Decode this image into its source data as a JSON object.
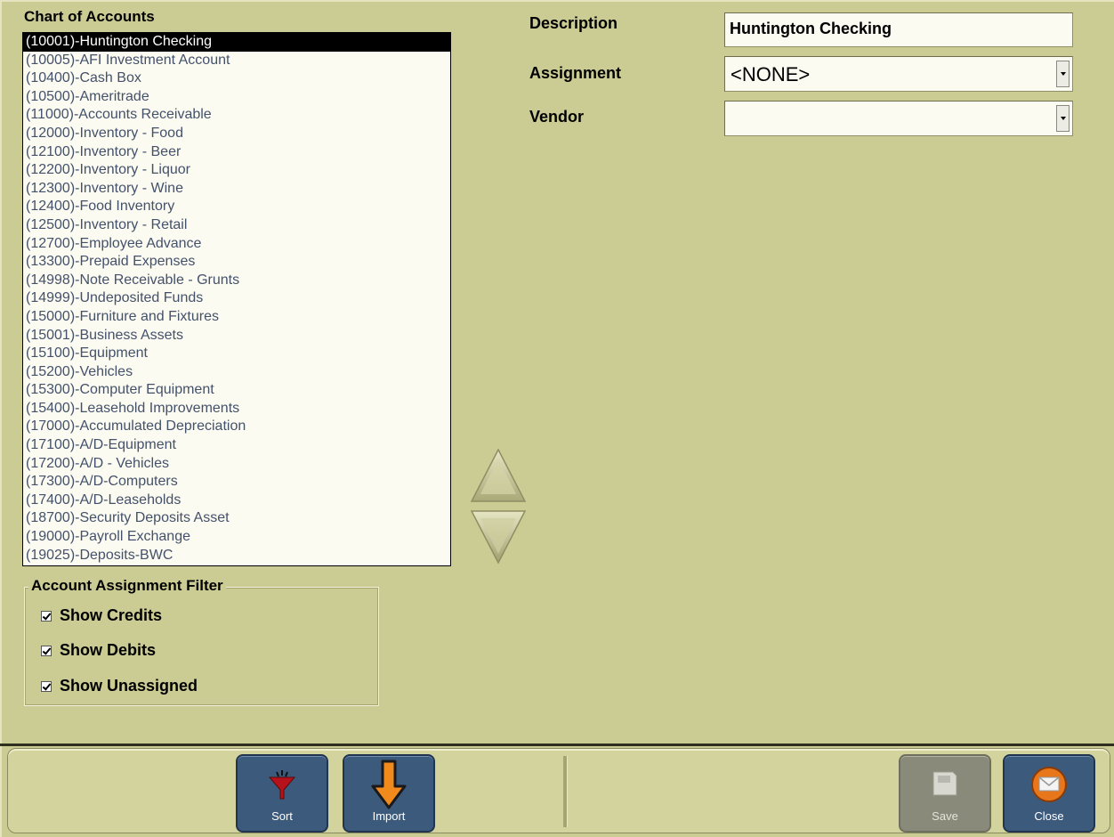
{
  "chart_of_accounts": {
    "title": "Chart of Accounts",
    "selected_index": 0,
    "items": [
      "(10001)-Huntington Checking",
      "(10005)-AFI Investment Account",
      "(10400)-Cash Box",
      "(10500)-Ameritrade",
      "(11000)-Accounts Receivable",
      "(12000)-Inventory - Food",
      "(12100)-Inventory - Beer",
      "(12200)-Inventory - Liquor",
      "(12300)-Inventory - Wine",
      "(12400)-Food Inventory",
      "(12500)-Inventory - Retail",
      "(12700)-Employee Advance",
      "(13300)-Prepaid Expenses",
      "(14998)-Note Receivable - Grunts",
      "(14999)-Undeposited Funds",
      "(15000)-Furniture and Fixtures",
      "(15001)-Business Assets",
      "(15100)-Equipment",
      "(15200)-Vehicles",
      "(15300)-Computer Equipment",
      "(15400)-Leasehold Improvements",
      "(17000)-Accumulated Depreciation",
      "(17100)-A/D-Equipment",
      "(17200)-A/D - Vehicles",
      "(17300)-A/D-Computers",
      "(17400)-A/D-Leaseholds",
      "(18700)-Security Deposits Asset",
      "(19000)-Payroll Exchange",
      "(19025)-Deposits-BWC"
    ]
  },
  "filter": {
    "legend": "Account Assignment Filter",
    "show_credits": "Show Credits",
    "show_debits": "Show Debits",
    "show_unassigned": "Show Unassigned"
  },
  "form": {
    "description_label": "Description",
    "description_value": "Huntington Checking",
    "assignment_label": "Assignment",
    "assignment_value": "<NONE>",
    "vendor_label": "Vendor",
    "vendor_value": ""
  },
  "toolbar": {
    "sort_label": "Sort",
    "import_label": "Import",
    "save_label": "Save",
    "close_label": "Close"
  },
  "icons": {
    "sort": "funnel-icon",
    "import": "down-arrow-icon",
    "save": "save-icon",
    "close": "envelope-icon",
    "move_up": "triangle-up-icon",
    "move_down": "triangle-down-icon"
  }
}
